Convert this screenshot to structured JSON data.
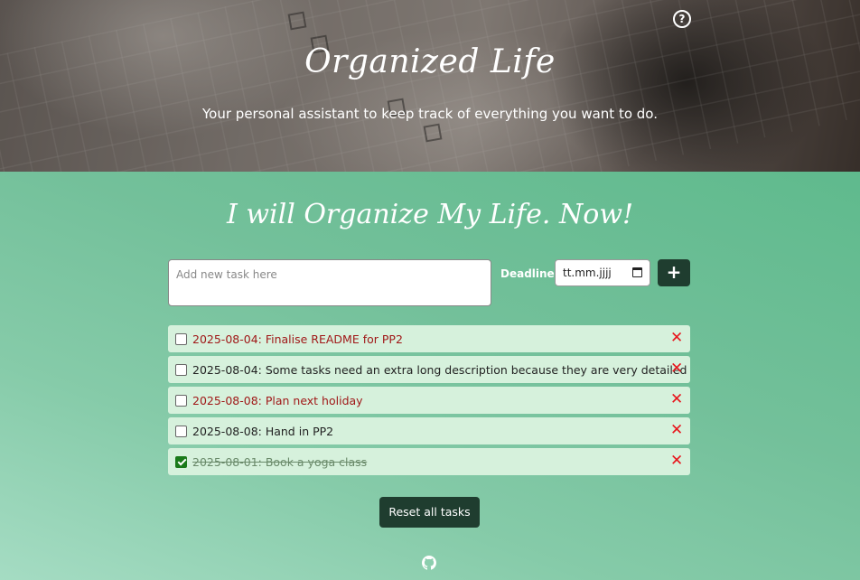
{
  "header": {
    "title": "Organized Life",
    "subtitle": "Your personal assistant to keep track of everything you want to do.",
    "help_icon": "question-circle-icon"
  },
  "main": {
    "title": "I will Organize My Life. Now!",
    "task_input_placeholder": "Add new task here",
    "deadline_label": "Deadline:",
    "date_placeholder": "tt.mm.jjjj",
    "add_button_label": "+",
    "reset_button_label": "Reset all tasks"
  },
  "tasks": [
    {
      "text": "2025-08-04: Finalise README for PP2",
      "checked": false,
      "status": "overdue"
    },
    {
      "text": "2025-08-04: Some tasks need an extra long description because they are very detailed",
      "checked": false,
      "status": "normal"
    },
    {
      "text": "2025-08-08: Plan next holiday",
      "checked": false,
      "status": "overdue"
    },
    {
      "text": "2025-08-08: Hand in PP2",
      "checked": false,
      "status": "normal"
    },
    {
      "text": "2025-08-01: Book a yoga class",
      "checked": true,
      "status": "done"
    }
  ],
  "colors": {
    "accent_dark": "#1f3d2f",
    "task_bg": "#d6f1dc",
    "delete": "#e8141b",
    "overdue_text": "#a01818"
  },
  "footer": {
    "icon": "github-icon"
  }
}
